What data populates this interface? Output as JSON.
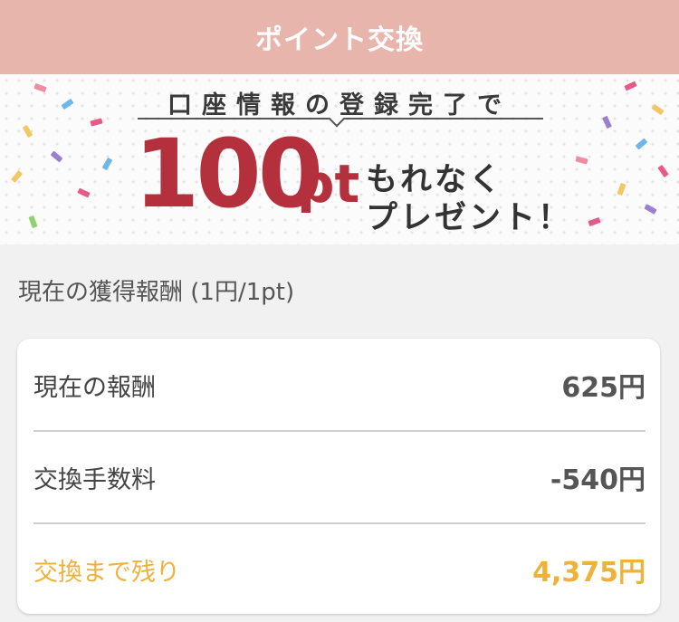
{
  "header": {
    "title": "ポイント交換"
  },
  "banner": {
    "headline": "口座情報の登録完了で",
    "amount": "100",
    "unit": "pt",
    "line1": "もれなく",
    "line2": "プレゼント！"
  },
  "section": {
    "title": "現在の獲得報酬 (1円/1pt)"
  },
  "summary": {
    "rows": [
      {
        "label": "現在の報酬",
        "value": "625円"
      },
      {
        "label": "交換手数料",
        "value": "-540円"
      },
      {
        "label": "交換まで残り",
        "value": "4,375円"
      }
    ]
  },
  "colors": {
    "header_bg": "#e8b5ac",
    "accent_red": "#b5303d",
    "remain_orange": "#eeb13a"
  }
}
